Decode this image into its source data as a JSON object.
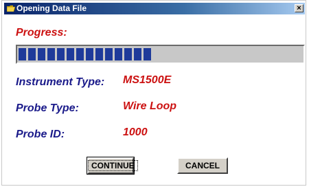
{
  "window": {
    "title": "Opening Data File",
    "icon": "folder-open-icon",
    "close_label": "×"
  },
  "progress": {
    "label": "Progress:",
    "fraction": 0.48
  },
  "fields": {
    "instrument_type": {
      "label": "Instrument Type:",
      "value": "MS1500E"
    },
    "probe_type": {
      "label": "Probe Type:",
      "value": "Wire Loop"
    },
    "probe_id": {
      "label": "Probe ID:",
      "value": "1000"
    }
  },
  "buttons": {
    "continue_label": "CONTINUE",
    "cancel_label": "CANCEL"
  },
  "colors": {
    "label_red": "#cc1111",
    "label_blue": "#1a1a8a",
    "progress_fill": "#1e3a9a"
  }
}
